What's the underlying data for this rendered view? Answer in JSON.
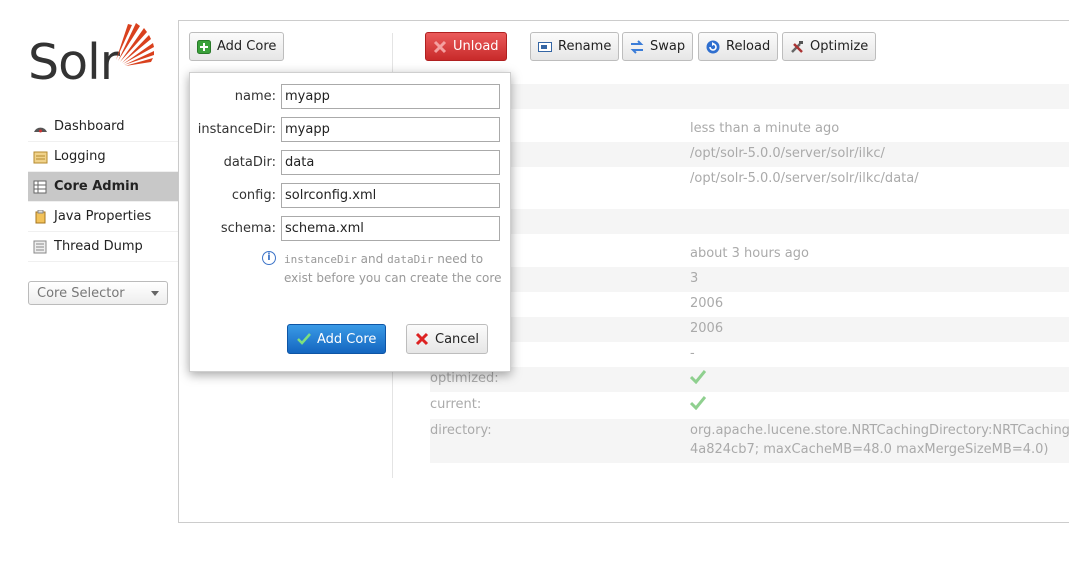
{
  "brand": {
    "logo_text": "Solr",
    "accent": "#d9411e"
  },
  "sidebar": {
    "items": [
      {
        "label": "Dashboard",
        "icon": "dashboard-icon"
      },
      {
        "label": "Logging",
        "icon": "logging-icon"
      },
      {
        "label": "Core Admin",
        "icon": "core-admin-icon",
        "active": true
      },
      {
        "label": "Java Properties",
        "icon": "java-properties-icon"
      },
      {
        "label": "Thread Dump",
        "icon": "thread-dump-icon"
      }
    ],
    "core_selector": "Core Selector"
  },
  "toolbar": {
    "add_core": "Add Core",
    "unload": "Unload",
    "rename": "Rename",
    "swap": "Swap",
    "reload": "Reload",
    "optimize": "Optimize"
  },
  "details": {
    "start_time": "less than a minute ago",
    "instance_dir": "/opt/solr-5.0.0/server/solr/ilkc/",
    "data_dir": "/opt/solr-5.0.0/server/solr/ilkc/data/",
    "last_modified": "about 3 hours ago",
    "version": "3",
    "num_docs": "2006",
    "max_doc": "2006",
    "deleted_docs": "-",
    "optimized_label": "optimized:",
    "current_label": "current:",
    "directory_label": "directory:",
    "directory_line1": "org.apache.lucene.store.NRTCachingDirectory:NRTCachingDi",
    "directory_line2": "4a824cb7; maxCacheMB=48.0 maxMergeSizeMB=4.0)"
  },
  "dialog": {
    "fields": [
      {
        "label": "name:",
        "value": "myapp"
      },
      {
        "label": "instanceDir:",
        "value": "myapp"
      },
      {
        "label": "dataDir:",
        "value": "data"
      },
      {
        "label": "config:",
        "value": "solrconfig.xml"
      },
      {
        "label": "schema:",
        "value": "schema.xml"
      }
    ],
    "hint_code1": "instanceDir",
    "hint_and": " and ",
    "hint_code2": "dataDir",
    "hint_rest": " need to exist before you can create the core",
    "submit": "Add Core",
    "cancel": "Cancel"
  }
}
